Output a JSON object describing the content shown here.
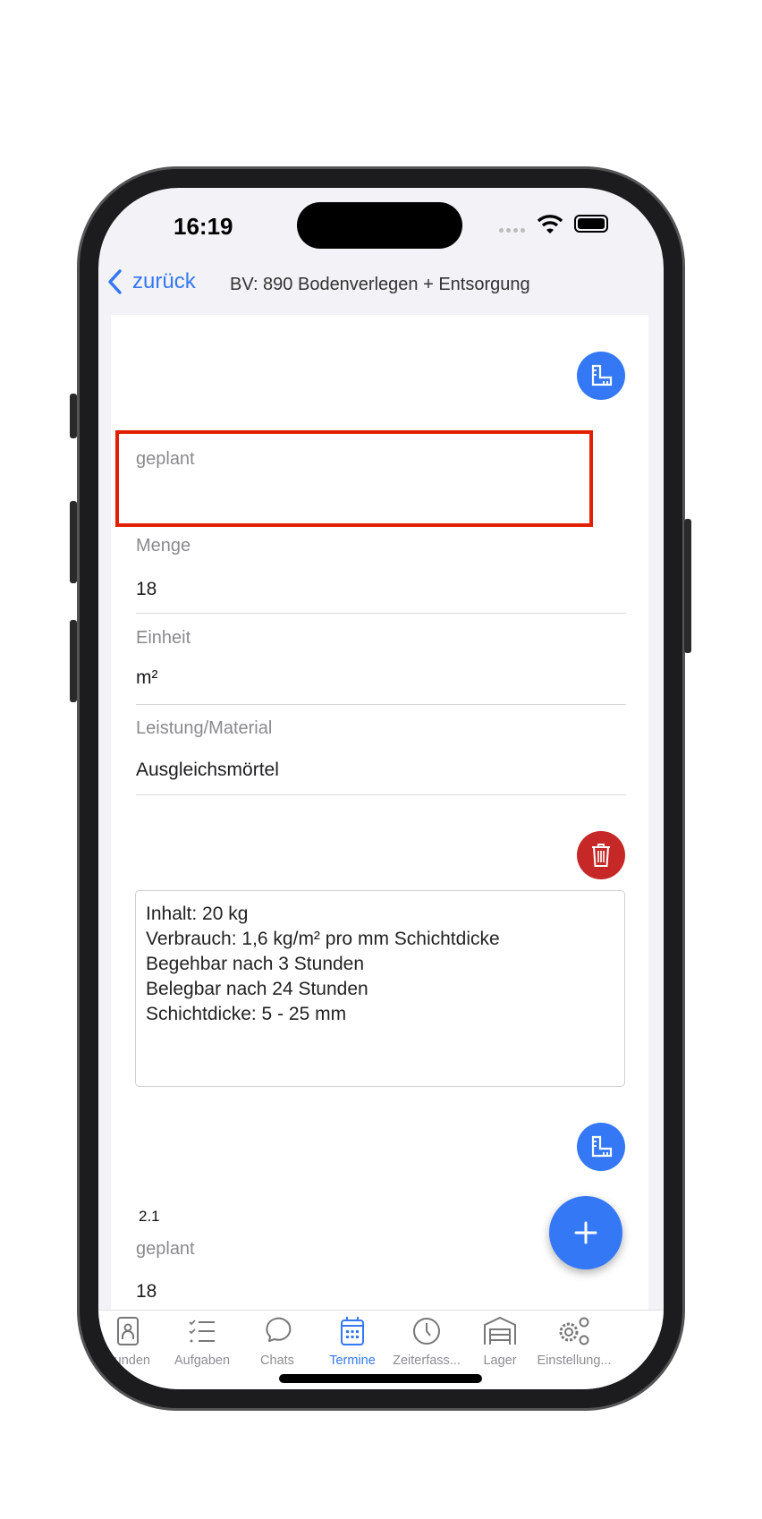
{
  "status": {
    "time": "16:19"
  },
  "nav": {
    "back_label": "zurück",
    "title": "BV: 890 Bodenverlegen + Entsorgung"
  },
  "form": {
    "geplant_label": "geplant",
    "geplant_value": "",
    "menge_label": "Menge",
    "menge_value": "18",
    "einheit_label": "Einheit",
    "einheit_value": "m²",
    "leistung_label": "Leistung/Material",
    "leistung_value": "Ausgleichsmörtel",
    "description": "Inhalt: 20 kg\nVerbrauch: 1,6 kg/m² pro mm Schichtdicke\nBegehbar nach 3 Stunden\nBelegbar nach 24 Stunden\nSchichtdicke: 5 - 25 mm",
    "next_index": "2.1",
    "next_geplant_label": "geplant",
    "next_geplant_value": "18"
  },
  "tabs": [
    {
      "label": "Kunden",
      "icon": "contacts-book-icon"
    },
    {
      "label": "Aufgaben",
      "icon": "checklist-icon"
    },
    {
      "label": "Chats",
      "icon": "chat-bubble-icon"
    },
    {
      "label": "Termine",
      "icon": "calendar-icon",
      "active": true
    },
    {
      "label": "Zeiterfass...",
      "icon": "clock-icon"
    },
    {
      "label": "Lager",
      "icon": "warehouse-icon"
    },
    {
      "label": "Einstellung...",
      "icon": "gears-icon"
    }
  ],
  "colors": {
    "accent": "#3478f6",
    "danger": "#c62828",
    "highlight": "#e02000"
  }
}
